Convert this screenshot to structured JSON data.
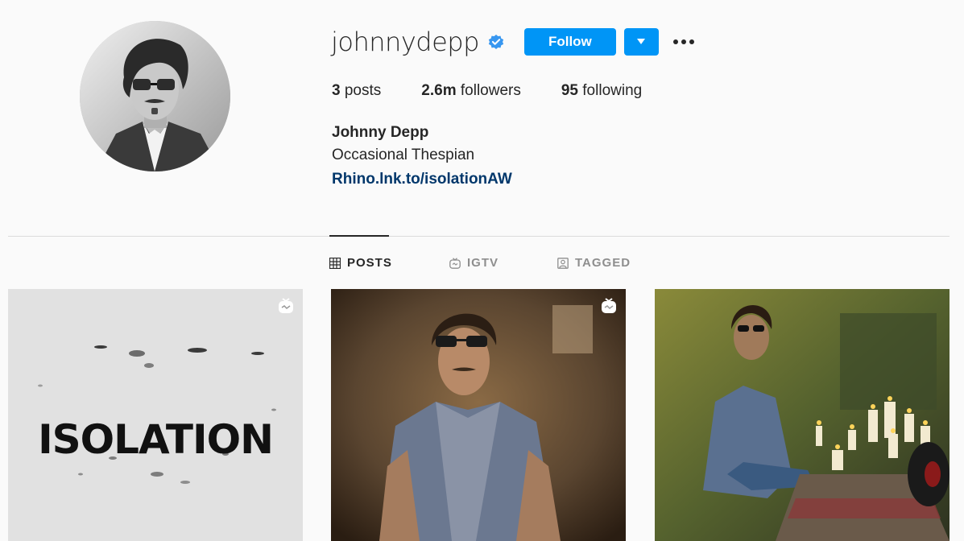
{
  "profile": {
    "username": "johnnydepp",
    "verified": true,
    "follow_label": "Follow",
    "dropdown_icon": "caret-down-icon",
    "more_icon": "more-options-icon",
    "avatar_icon": "profile-photo"
  },
  "stats": {
    "posts_count": "3",
    "posts_label": "posts",
    "followers_count": "2.6m",
    "followers_label": "followers",
    "following_count": "95",
    "following_label": "following"
  },
  "bio": {
    "full_name": "Johnny Depp",
    "description": "Occasional Thespian",
    "link": "Rhino.lnk.to/isolationAW"
  },
  "tabs": [
    {
      "label": "POSTS",
      "icon": "grid-icon",
      "active": true
    },
    {
      "label": "IGTV",
      "icon": "igtv-icon",
      "active": false
    },
    {
      "label": "TAGGED",
      "icon": "tagged-icon",
      "active": false
    }
  ],
  "posts": [
    {
      "caption_text": "ISOLATION",
      "badge_icon": "igtv-badge-icon",
      "type": "video"
    },
    {
      "caption_text": "",
      "badge_icon": "igtv-badge-icon",
      "type": "video"
    },
    {
      "caption_text": "",
      "badge_icon": "",
      "type": "image"
    }
  ],
  "colors": {
    "accent": "#0095f6",
    "link": "#00376b",
    "text": "#262626",
    "muted": "#8e8e8e",
    "background": "#fafafa",
    "divider": "#dbdbdb"
  }
}
